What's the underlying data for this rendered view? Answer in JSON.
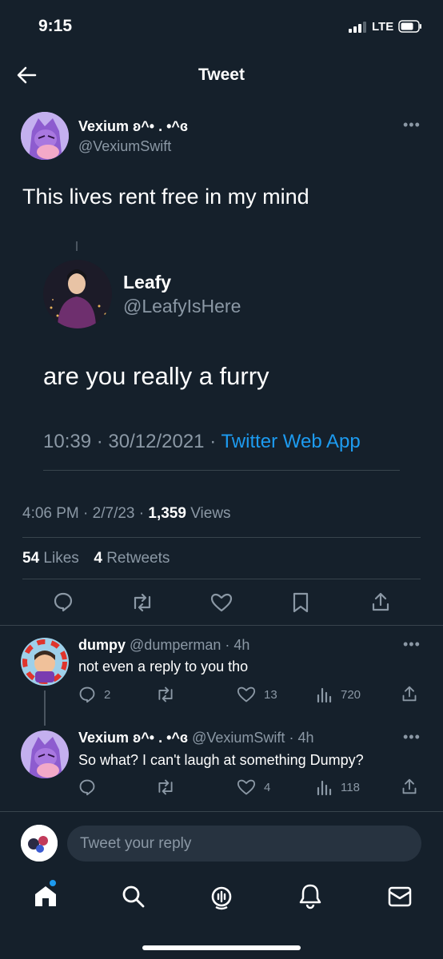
{
  "status_bar": {
    "time": "9:15",
    "network": "LTE"
  },
  "header": {
    "title": "Tweet"
  },
  "tweet": {
    "author_name": "Vexium ʚ^• . •^ɞ",
    "author_handle": "@VexiumSwift",
    "text": "This lives rent free in my mind",
    "time": "4:06 PM",
    "date": "2/7/23",
    "views_count": "1,359",
    "views_label": "Views",
    "likes_count": "54",
    "likes_label": "Likes",
    "retweets_count": "4",
    "retweets_label": "Retweets"
  },
  "quoted": {
    "author_name": "Leafy",
    "author_handle": "@LeafyIsHere",
    "text": "are you really a furry",
    "time": "10:39",
    "date": "30/12/2021",
    "source": "Twitter Web App"
  },
  "replies": [
    {
      "author_name": "dumpy",
      "author_handle": "@dumperman",
      "time": "4h",
      "text": "not even a reply to you tho",
      "replies": "2",
      "likes": "13",
      "views": "720"
    },
    {
      "author_name": "Vexium ʚ^• . •^ɞ",
      "author_handle": "@VexiumSwift",
      "time": "4h",
      "text": "So what? I can't laugh at something Dumpy?",
      "replies": "",
      "likes": "4",
      "views": "118"
    }
  ],
  "composer": {
    "placeholder": "Tweet your reply"
  },
  "colors": {
    "background": "#15202b",
    "accent": "#1d9bf0",
    "muted": "#8b98a5",
    "divider": "#38444d"
  },
  "icons": [
    "back-arrow-icon",
    "more-icon",
    "reply-icon",
    "retweet-icon",
    "like-icon",
    "bookmark-icon",
    "share-icon",
    "views-icon",
    "home-icon",
    "search-icon",
    "spaces-icon",
    "notifications-icon",
    "messages-icon"
  ]
}
